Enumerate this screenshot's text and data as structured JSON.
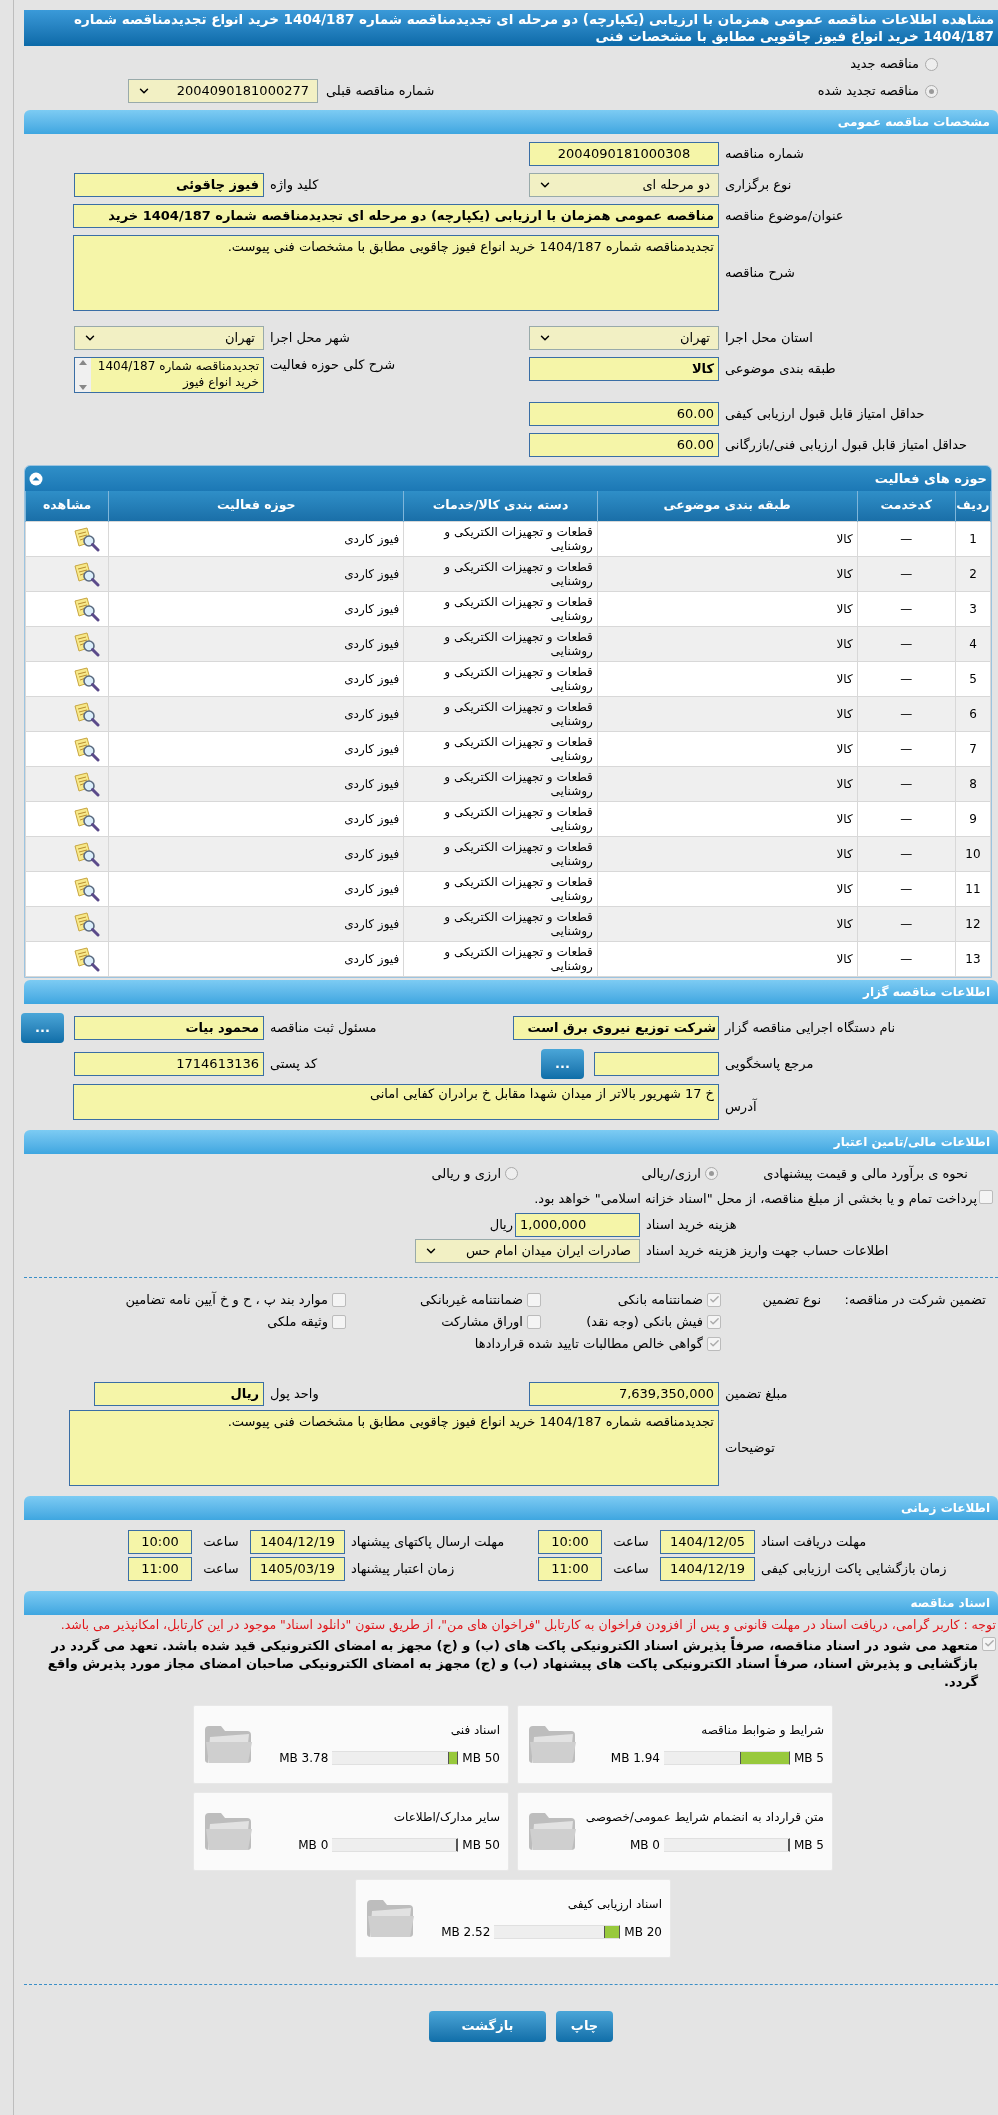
{
  "title": "مشاهده اطلاعات مناقصه عمومی همزمان با ارزیابی (یکپارچه) دو مرحله ای تجدیدمناقصه شماره 1404/187 خرید انواع تجدیدمناقصه شماره 1404/187 خرید انواع فیوز چاقویی مطابق با مشخصات فنی",
  "tender_kind": [
    {
      "label": "مناقصه جدید",
      "selected": false
    },
    {
      "label": "مناقصه تجدید شده",
      "selected": true
    }
  ],
  "previous_tender": {
    "label": "شماره مناقصه قبلی",
    "value": "2004090181000277"
  },
  "general": {
    "header": "مشخصات مناقصه عمومی",
    "tender_number": {
      "label": "شماره مناقصه",
      "value": "2004090181000308"
    },
    "holding_type": {
      "label": "نوع برگزاری",
      "value": "دو مرحله ای"
    },
    "keyword": {
      "label": "کلید واژه",
      "value": "فیوز چاقوئی"
    },
    "subject": {
      "label": "عنوان/موضوع مناقصه",
      "value": "مناقصه عمومی همزمان با ارزیابی (یکپارچه) دو مرحله ای تجدیدمناقصه شماره 1404/187 خرید"
    },
    "description": {
      "label": "شرح مناقصه",
      "value": "تجدیدمناقصه شماره 1404/187 خرید انواع فیوز چاقویی مطابق با مشخصات فنی پیوست."
    },
    "province": {
      "label": "استان محل اجرا",
      "value": "تهران"
    },
    "city": {
      "label": "شهر محل اجرا",
      "value": "تهران"
    },
    "category": {
      "label": "طبقه بندی موضوعی",
      "value": "کالا"
    },
    "activity_summary": {
      "label": "شرح کلی حوزه فعالیت",
      "value": "تجدیدمناقصه شماره 1404/187 خرید انواع فیوز"
    },
    "min_quality_score": {
      "label": "حداقل امتیاز قابل قبول ارزیابی کیفی",
      "value": "60.00"
    },
    "min_technical_score": {
      "label": "حداقل امتیاز قابل قبول ارزیابی فنی/بازرگانی",
      "value": "60.00"
    }
  },
  "activities": {
    "title": "حوزه های فعالیت",
    "columns": [
      "ردیف",
      "کدخدمت",
      "طبقه بندی موضوعی",
      "دسته بندی کالا/خدمات",
      "حوزه فعالیت",
      "مشاهده"
    ],
    "rows": [
      [
        "1",
        "—",
        "کالا",
        "قطعات و تجهیزات الکتریکی و روشنایی",
        "فیوز کاردی"
      ],
      [
        "2",
        "—",
        "کالا",
        "قطعات و تجهیزات الکتریکی و روشنایی",
        "فیوز کاردی"
      ],
      [
        "3",
        "—",
        "کالا",
        "قطعات و تجهیزات الکتریکی و روشنایی",
        "فیوز کاردی"
      ],
      [
        "4",
        "—",
        "کالا",
        "قطعات و تجهیزات الکتریکی و روشنایی",
        "فیوز کاردی"
      ],
      [
        "5",
        "—",
        "کالا",
        "قطعات و تجهیزات الکتریکی و روشنایی",
        "فیوز کاردی"
      ],
      [
        "6",
        "—",
        "کالا",
        "قطعات و تجهیزات الکتریکی و روشنایی",
        "فیوز کاردی"
      ],
      [
        "7",
        "—",
        "کالا",
        "قطعات و تجهیزات الکتریکی و روشنایی",
        "فیوز کاردی"
      ],
      [
        "8",
        "—",
        "کالا",
        "قطعات و تجهیزات الکتریکی و روشنایی",
        "فیوز کاردی"
      ],
      [
        "9",
        "—",
        "کالا",
        "قطعات و تجهیزات الکتریکی و روشنایی",
        "فیوز کاردی"
      ],
      [
        "10",
        "—",
        "کالا",
        "قطعات و تجهیزات الکتریکی و روشنایی",
        "فیوز کاردی"
      ],
      [
        "11",
        "—",
        "کالا",
        "قطعات و تجهیزات الکتریکی و روشنایی",
        "فیوز کاردی"
      ],
      [
        "12",
        "—",
        "کالا",
        "قطعات و تجهیزات الکتریکی و روشنایی",
        "فیوز کاردی"
      ],
      [
        "13",
        "—",
        "کالا",
        "قطعات و تجهیزات الکتریکی و روشنایی",
        "فیوز کاردی"
      ]
    ]
  },
  "organizer": {
    "header": "اطلاعات مناقصه گزار",
    "agency": {
      "label": "نام دستگاه اجرایی مناقصه گزار",
      "value": "شرکت توزیع نیروی برق است"
    },
    "registrar": {
      "label": "مسئول ثبت مناقصه",
      "value": "محمود  بیات",
      "button": "..."
    },
    "reference": {
      "label": "مرجع پاسخگویی",
      "button": "..."
    },
    "postal_code": {
      "label": "کد پستی",
      "value": "1714613136"
    },
    "address": {
      "label": "آدرس",
      "value": "خ 17 شهریور بالاتر از میدان شهدا مقابل خ برادران کفایی امانی"
    }
  },
  "finance": {
    "header": "اطلاعات مالی/تامین اعتبار",
    "estimate_label": "نحوه ی برآورد مالی و قیمت پیشنهادی",
    "currency_options": [
      {
        "label": "ارزی/ریالی",
        "selected": true
      },
      {
        "label": "ارزی و ریالی",
        "selected": false
      }
    ],
    "treasury": {
      "label": "پرداخت تمام و یا بخشی از مبلغ مناقصه، از محل \"اسناد خزانه اسلامی\" خواهد بود.",
      "checked": false
    },
    "doc_fee": {
      "label": "هزینه خرید اسناد",
      "value": "1,000,000",
      "unit": "ریال"
    },
    "account": {
      "label": "اطلاعات حساب جهت واریز هزینه خرید اسناد",
      "value": "صادرات ایران میدان امام حس"
    }
  },
  "guarantee": {
    "label": "تضمین شرکت در مناقصه:",
    "type_label": "نوع تضمین",
    "options": [
      {
        "label": "ضمانتنامه بانکی",
        "checked": true
      },
      {
        "label": "ضمانتنامه غیربانکی",
        "checked": false
      },
      {
        "label": "موارد بند پ ، ح و خ آیین نامه تضامین",
        "checked": false
      },
      {
        "label": "فیش بانکی (وجه نقد)",
        "checked": true
      },
      {
        "label": "اوراق مشارکت",
        "checked": false
      },
      {
        "label": "وثیقه ملکی",
        "checked": false
      },
      {
        "label": "گواهی خالص مطالبات تایید شده قراردادها",
        "checked": true
      }
    ],
    "amount": {
      "label": "مبلغ تضمین",
      "value": "7,639,350,000"
    },
    "currency": {
      "label": "واحد پول",
      "value": "ریال"
    },
    "notes": {
      "label": "توضیحات",
      "value": "تجدیدمناقصه شماره 1404/187 خرید انواع فیوز چاقویی مطابق با مشخصات فنی پیوست."
    }
  },
  "timing": {
    "header": "اطلاعات زمانی",
    "items": [
      {
        "label": "مهلت دریافت اسناد",
        "date": "1404/12/05",
        "hour_label": "ساعت",
        "time": "10:00"
      },
      {
        "label": "مهلت ارسال پاکتهای پیشنهاد",
        "date": "1404/12/19",
        "hour_label": "ساعت",
        "time": "10:00"
      },
      {
        "label": "زمان بازگشایی پاکت ارزیابی کیفی",
        "date": "1404/12/19",
        "hour_label": "ساعت",
        "time": "11:00"
      },
      {
        "label": "زمان اعتبار پیشنهاد",
        "date": "1405/03/19",
        "hour_label": "ساعت",
        "time": "11:00"
      }
    ]
  },
  "documents": {
    "header": "اسناد مناقصه",
    "notice": "توجه : کاربر گرامی، دریافت اسناد در مهلت قانونی و پس از افزودن فراخوان به کارتابل \"فراخوان های من\"، از طریق ستون \"دانلود اسناد\" موجود در این کارتابل، امکانپذیر می باشد.",
    "commitment": {
      "text": "متعهد می شود در اسناد مناقصه، صرفاً پذیرش اسناد الکترونیکی پاکت های (ب) و (ج) مجهز به امضای الکترونیکی قید شده باشد. تعهد می گردد در بازگشایی و پذیرش اسناد، صرفاً اسناد الکترونیکی پاکت های پیشنهاد (ب) و (ج) مجهز به امضای الکترونیکی صاحبان امضای مجاز مورد پذیرش واقع گردد.",
      "checked": true
    },
    "files": [
      {
        "title": "شرایط و ضوابط مناقصه",
        "used": "1.94 MB",
        "limit": "5 MB",
        "level": 0.388
      },
      {
        "title": "اسناد فنی",
        "used": "3.78 MB",
        "limit": "50 MB",
        "level": 0.076
      },
      {
        "title": "متن قرارداد به انضمام شرایط عمومی/خصوصی",
        "used": "0 MB",
        "limit": "5 MB",
        "level": 0
      },
      {
        "title": "سایر مدارک/اطلاعات",
        "used": "0 MB",
        "limit": "50 MB",
        "level": 0
      },
      {
        "title": "اسناد ارزیابی کیفی",
        "used": "2.52 MB",
        "limit": "20 MB",
        "level": 0.126
      }
    ]
  },
  "buttons": [
    "چاپ",
    "بازگشت"
  ]
}
